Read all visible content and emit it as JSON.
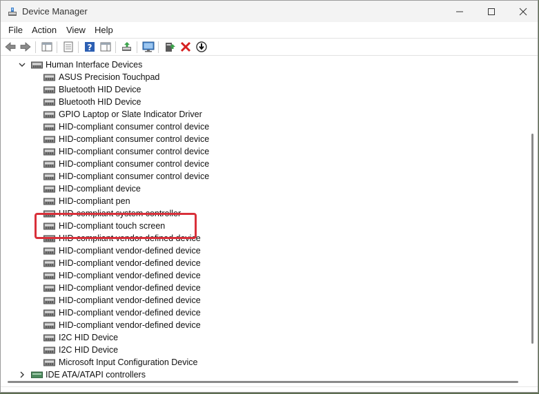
{
  "window": {
    "title": "Device Manager"
  },
  "menu": {
    "file": "File",
    "action": "Action",
    "view": "View",
    "help": "Help"
  },
  "tree": {
    "category": "Human Interface Devices",
    "devices": [
      "ASUS Precision Touchpad",
      "Bluetooth HID Device",
      "Bluetooth HID Device",
      "GPIO Laptop or Slate Indicator Driver",
      "HID-compliant consumer control device",
      "HID-compliant consumer control device",
      "HID-compliant consumer control device",
      "HID-compliant consumer control device",
      "HID-compliant consumer control device",
      "HID-compliant device",
      "HID-compliant pen",
      "HID-compliant system controller",
      "HID-compliant touch screen",
      "HID-compliant vendor-defined device",
      "HID-compliant vendor-defined device",
      "HID-compliant vendor-defined device",
      "HID-compliant vendor-defined device",
      "HID-compliant vendor-defined device",
      "HID-compliant vendor-defined device",
      "HID-compliant vendor-defined device",
      "HID-compliant vendor-defined device",
      "I2C HID Device",
      "I2C HID Device",
      "Microsoft Input Configuration Device"
    ],
    "next_category": "IDE ATA/ATAPI controllers"
  },
  "colors": {
    "highlight": "#d9303a",
    "accent": "#0067c0"
  }
}
